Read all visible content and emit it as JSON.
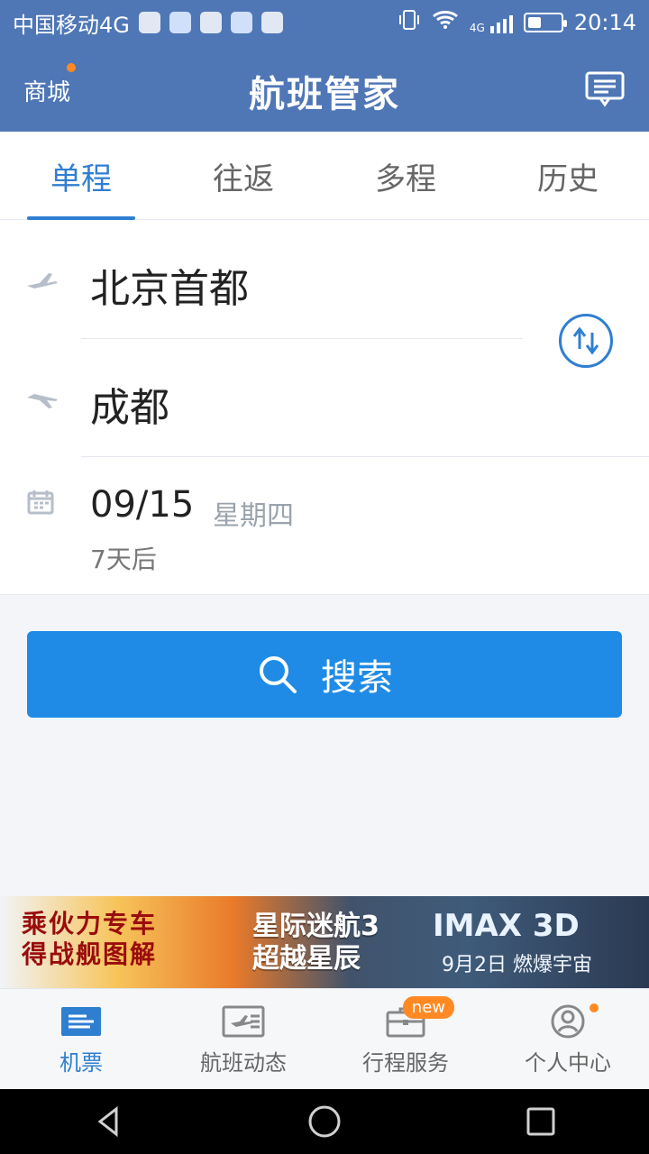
{
  "status_bar": {
    "carrier": "中国移动4G",
    "time": "20:14",
    "network_badge": "4G",
    "icons": [
      "app-icon-1",
      "app-icon-2",
      "app-icon-3",
      "app-icon-4",
      "app-icon-5",
      "vibrate-icon",
      "wifi-icon",
      "signal-icon",
      "battery-icon"
    ]
  },
  "header": {
    "mall_label": "商城",
    "title": "航班管家",
    "message_icon": "message-icon",
    "accent_dot_color": "#ff8a24"
  },
  "tabs": [
    {
      "label": "单程",
      "active": true
    },
    {
      "label": "往返",
      "active": false
    },
    {
      "label": "多程",
      "active": false
    },
    {
      "label": "历史",
      "active": false
    }
  ],
  "form": {
    "from_city": "北京首都",
    "to_city": "成都",
    "date": "09/15",
    "weekday": "星期四",
    "days_after": "7天后",
    "swap_icon": "swap-icon"
  },
  "search_button": {
    "label": "搜索",
    "icon": "search-icon",
    "color": "#1f8be6"
  },
  "banner": {
    "left_line1": "乘伙力专车",
    "left_line2": "得战舰图解",
    "mid_line1": "星际迷航3",
    "mid_line2": "超越星辰",
    "right_line1": "IMAX 3D",
    "right_line2": "9月2日 燃爆宇宙"
  },
  "bottom_nav": [
    {
      "label": "机票",
      "icon": "ticket-icon",
      "active": true
    },
    {
      "label": "航班动态",
      "icon": "flight-status-icon",
      "active": false
    },
    {
      "label": "行程服务",
      "icon": "briefcase-icon",
      "active": false,
      "badge": "new"
    },
    {
      "label": "个人中心",
      "icon": "user-icon",
      "active": false,
      "dot": true
    }
  ],
  "system_nav": {
    "back": "back-icon",
    "home": "home-icon",
    "recent": "recent-apps-icon"
  }
}
